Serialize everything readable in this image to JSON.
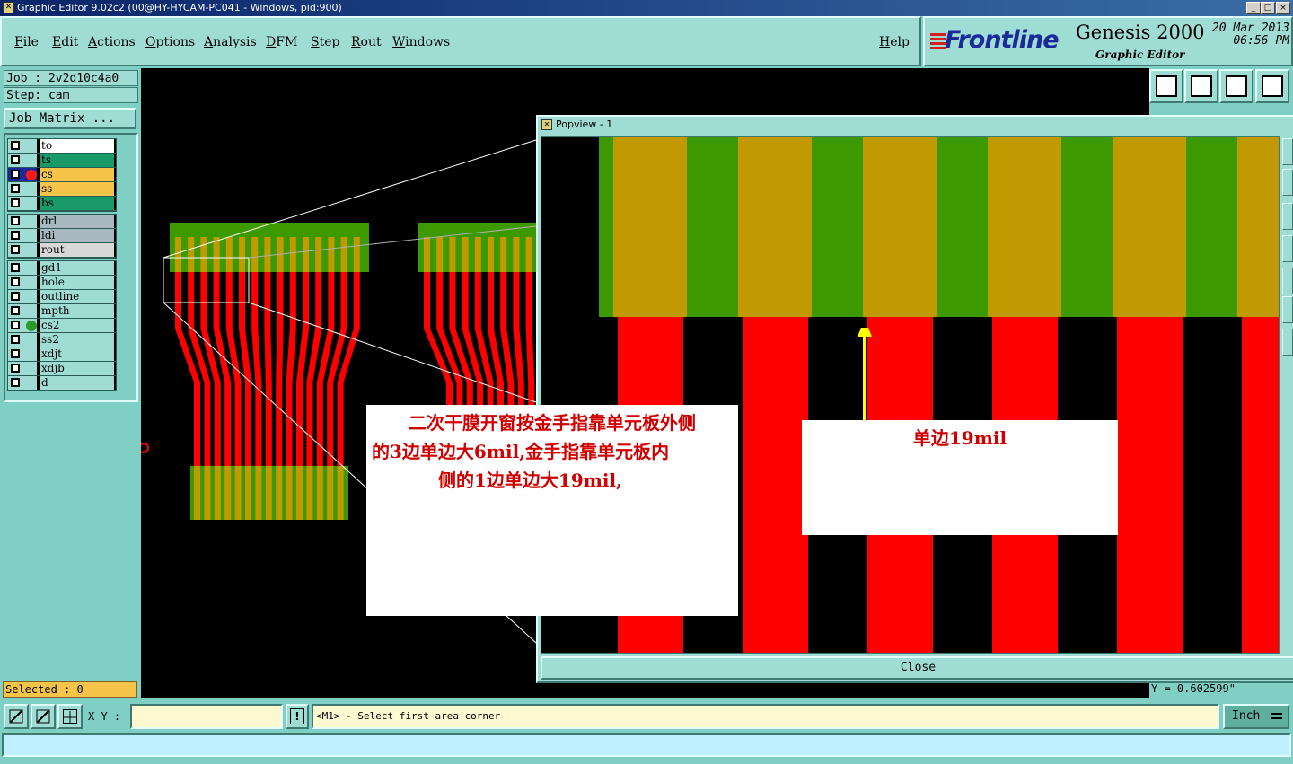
{
  "window": {
    "title": "Graphic Editor 9.02c2 (00@HY-HYCAM-PC041 - Windows, pid:900)",
    "controls": [
      "_",
      "□",
      "×"
    ]
  },
  "menu": [
    "File",
    "Edit",
    "Actions",
    "Options",
    "Analysis",
    "DFM",
    "Step",
    "Rout",
    "Windows"
  ],
  "help_label": "Help",
  "logo": {
    "brand": "Frontline",
    "product": "Genesis 2000",
    "subtitle": "Graphic Editor",
    "date": "20 Mar 2013",
    "time": "06:56 PM"
  },
  "job": {
    "job_label": "Job : 2v2d10c4a0",
    "step_label": "Step: cam",
    "matrix_button": "Job Matrix ..."
  },
  "layers": {
    "group1": [
      {
        "name": "to",
        "color": "#ffffff",
        "dot": ""
      },
      {
        "name": "ts",
        "color": "#1a9a6a",
        "dot": ""
      },
      {
        "name": "cs",
        "color": "#f7c44a",
        "dot": "#ff1a1a",
        "active": true
      },
      {
        "name": "ss",
        "color": "#f7c44a",
        "dot": ""
      },
      {
        "name": "bs",
        "color": "#1a9a6a",
        "dot": ""
      }
    ],
    "group2": [
      {
        "name": "drl",
        "color": "#a8b8c0",
        "dot": ""
      },
      {
        "name": "ldi",
        "color": "#a8b8c0",
        "dot": ""
      },
      {
        "name": "rout",
        "color": "#d8d8d8",
        "dot": ""
      }
    ],
    "group3": [
      {
        "name": "gd1",
        "color": "#9fdcd3",
        "dot": ""
      },
      {
        "name": "hole",
        "color": "#9fdcd3",
        "dot": ""
      },
      {
        "name": "outline",
        "color": "#9fdcd3",
        "dot": ""
      },
      {
        "name": "mpth",
        "color": "#9fdcd3",
        "dot": ""
      },
      {
        "name": "cs2",
        "color": "#9fdcd3",
        "dot": "#2a9a2a"
      },
      {
        "name": "ss2",
        "color": "#9fdcd3",
        "dot": ""
      },
      {
        "name": "xdjt",
        "color": "#9fdcd3",
        "dot": ""
      },
      {
        "name": "xdjb",
        "color": "#9fdcd3",
        "dot": ""
      },
      {
        "name": "d",
        "color": "#9fdcd3",
        "dot": ""
      }
    ]
  },
  "selected_label": "Selected : 0",
  "popview": {
    "title": "Popview - 1",
    "close_label": "Close"
  },
  "annotations": {
    "main_note": [
      "二次干膜开窗按金手指靠单元板外侧",
      "的3边单边大6mil,金手指靠单元板内",
      "侧的1边单边大19mil,"
    ],
    "pop_note": "单边19mil"
  },
  "coord_y": "Y = 0.602599\"",
  "bottom": {
    "xy_label": "X Y :",
    "xy_value": "",
    "prompt": "<M1> - Select first area corner",
    "unit": "Inch"
  },
  "colors": {
    "copper": "#ff0000",
    "gold": "#c09a00",
    "mask": "#3c9a00",
    "panel": "#9fdcd3"
  }
}
